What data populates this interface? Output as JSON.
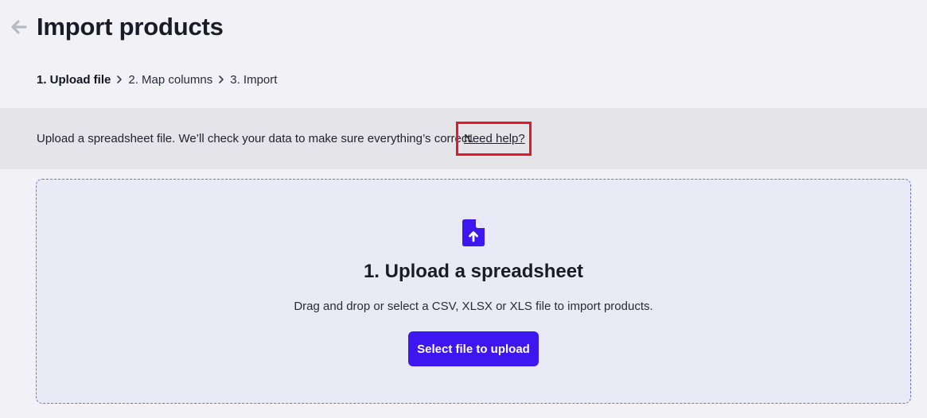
{
  "header": {
    "title": "Import products",
    "back_icon": "arrow-left-icon"
  },
  "steps": [
    {
      "label": "1. Upload file",
      "active": true
    },
    {
      "label": "2. Map columns",
      "active": false
    },
    {
      "label": "3. Import",
      "active": false
    }
  ],
  "banner": {
    "text": "Upload a spreadsheet file. We’ll check your data to make sure everything’s correct.",
    "help_link": "Need help?"
  },
  "dropzone": {
    "icon": "file-upload-icon",
    "title": "1. Upload a spreadsheet",
    "description": "Drag and drop or select a CSV, XLSX or XLS file to import products.",
    "button_label": "Select file to upload"
  },
  "colors": {
    "accent": "#3d16f0",
    "highlight": "#e3182b",
    "banner_bg": "#e4e4e9",
    "dropzone_bg": "#e8ebf6"
  }
}
